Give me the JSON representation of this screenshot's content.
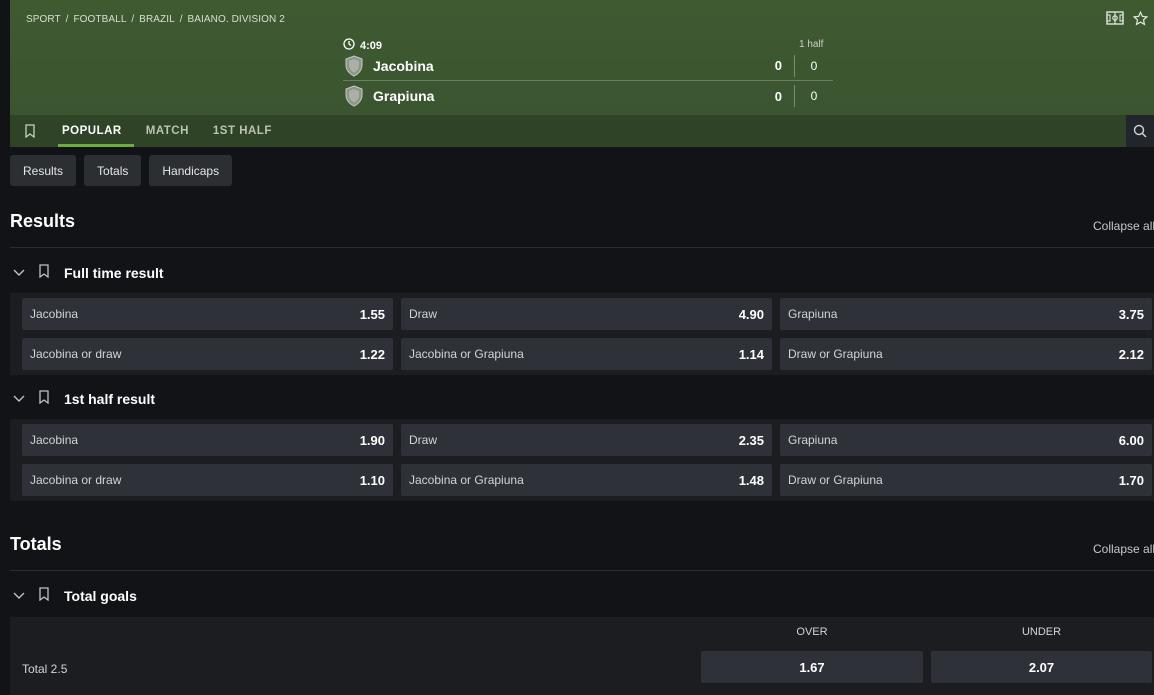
{
  "breadcrumb": [
    "SPORT",
    "FOOTBALL",
    "BRAZIL",
    "BAIANO. DIVISION 2"
  ],
  "breadcrumb_sep": "/",
  "match": {
    "clock": "4:09",
    "period_label": "1 half",
    "home": {
      "name": "Jacobina",
      "score": "0",
      "half_score": "0"
    },
    "away": {
      "name": "Grapiuna",
      "score": "0",
      "half_score": "0"
    }
  },
  "tabs": [
    {
      "label": "POPULAR",
      "active": true
    },
    {
      "label": "MATCH",
      "active": false
    },
    {
      "label": "1ST HALF",
      "active": false
    }
  ],
  "chips": [
    "Results",
    "Totals",
    "Handicaps"
  ],
  "sections": {
    "results": {
      "title": "Results",
      "collapse_label": "Collapse all",
      "markets": [
        {
          "title": "Full time result",
          "rows": [
            [
              {
                "label": "Jacobina",
                "odd": "1.55"
              },
              {
                "label": "Draw",
                "odd": "4.90"
              },
              {
                "label": "Grapiuna",
                "odd": "3.75"
              }
            ],
            [
              {
                "label": "Jacobina or draw",
                "odd": "1.22"
              },
              {
                "label": "Jacobina or Grapiuna",
                "odd": "1.14"
              },
              {
                "label": "Draw or Grapiuna",
                "odd": "2.12"
              }
            ]
          ]
        },
        {
          "title": "1st half result",
          "rows": [
            [
              {
                "label": "Jacobina",
                "odd": "1.90"
              },
              {
                "label": "Draw",
                "odd": "2.35"
              },
              {
                "label": "Grapiuna",
                "odd": "6.00"
              }
            ],
            [
              {
                "label": "Jacobina or draw",
                "odd": "1.10"
              },
              {
                "label": "Jacobina or Grapiuna",
                "odd": "1.48"
              },
              {
                "label": "Draw or Grapiuna",
                "odd": "1.70"
              }
            ]
          ]
        }
      ]
    },
    "totals": {
      "title": "Totals",
      "collapse_label": "Collapse all",
      "market_title": "Total goals",
      "headers": {
        "over": "OVER",
        "under": "UNDER"
      },
      "row": {
        "label": "Total 2.5",
        "over": "1.67",
        "under": "2.07"
      }
    }
  },
  "colors": {
    "banner": "#3f5a31",
    "tab_active_underline": "#6bb03f",
    "background": "#121316",
    "odd_cell": "#2e3137"
  },
  "icons": [
    "field-icon",
    "star-icon",
    "clock-icon",
    "team-shield-icon",
    "bookmark-icon",
    "chevron-down-icon",
    "search-icon"
  ]
}
